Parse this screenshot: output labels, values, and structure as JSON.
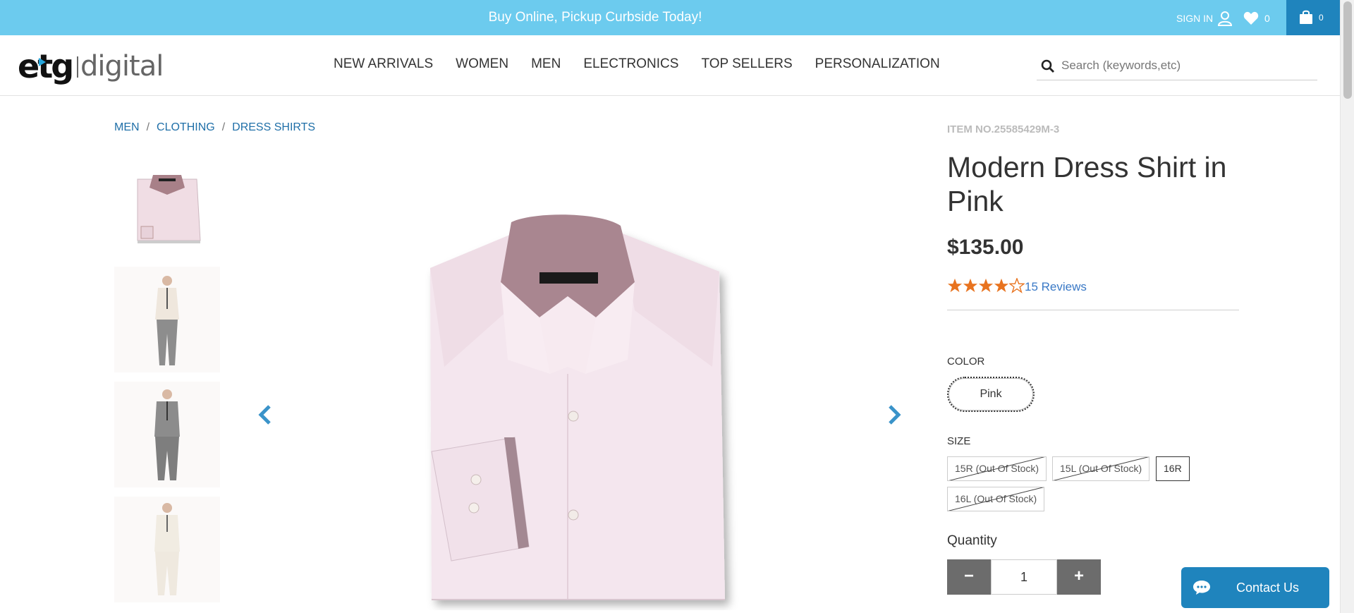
{
  "topbar": {
    "promo": "Buy Online, Pickup Curbside Today!",
    "sign_in": "SIGN IN",
    "wishlist_count": "0",
    "cart_count": "0"
  },
  "header": {
    "logo_left": "etg",
    "logo_right": "digital",
    "nav": [
      "NEW ARRIVALS",
      "WOMEN",
      "MEN",
      "ELECTRONICS",
      "TOP SELLERS",
      "PERSONALIZATION"
    ],
    "search_placeholder": "Search (keywords,etc)"
  },
  "breadcrumb": [
    "MEN",
    "CLOTHING",
    "DRESS SHIRTS"
  ],
  "product": {
    "item_no": "ITEM NO.25585429M-3",
    "title": "Modern Dress Shirt in Pink",
    "price": "$135.00",
    "rating": 4,
    "rating_max": 5,
    "reviews": "15 Reviews",
    "color_label": "COLOR",
    "color_selected": "Pink",
    "size_label": "SIZE",
    "sizes": [
      {
        "label": "15R (Out Of Stock)",
        "out_of_stock": true
      },
      {
        "label": "15L (Out Of Stock)",
        "out_of_stock": true
      },
      {
        "label": "16R",
        "out_of_stock": false,
        "selected": true
      },
      {
        "label": "16L (Out Of Stock)",
        "out_of_stock": true
      }
    ],
    "quantity_label": "Quantity",
    "quantity": "1",
    "minus": "−",
    "plus": "+"
  },
  "contact": {
    "label": "Contact Us"
  },
  "colors": {
    "topbar": "#6ccbee",
    "cart": "#1f84bd",
    "link": "#1f6fa8",
    "star": "#e8731f",
    "arrow": "#3a93c9"
  }
}
